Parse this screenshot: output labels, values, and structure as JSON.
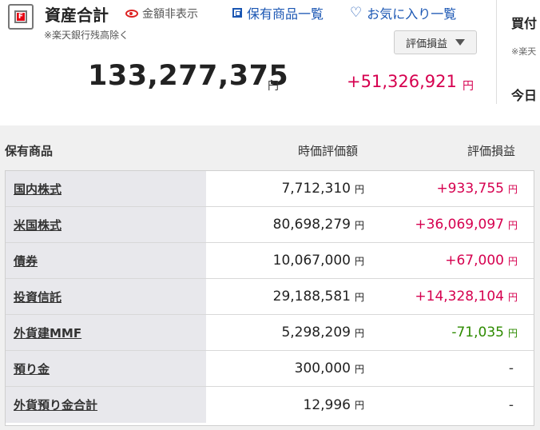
{
  "header": {
    "title": "資産合計",
    "hide_amount_label": "金額非表示",
    "note": "※楽天銀行残高除く",
    "link_holdings": "保有商品一覧",
    "link_favorites": "お気に入り一覧",
    "select_value": "評価損益"
  },
  "summary": {
    "total": "133,277,375",
    "total_unit": "円",
    "gain": "+51,326,921",
    "gain_unit": "円"
  },
  "right_column": {
    "line1": "買付",
    "line2": "※楽天",
    "line3": "今日"
  },
  "table": {
    "headers": {
      "name": "保有商品",
      "value": "時価評価額",
      "gain": "評価損益"
    },
    "rows": [
      {
        "name": "国内株式",
        "value": "7,712,310",
        "value_unit": "円",
        "gain": "+933,755",
        "gain_unit": "円",
        "sign": "pos"
      },
      {
        "name": "米国株式",
        "value": "80,698,279",
        "value_unit": "円",
        "gain": "+36,069,097",
        "gain_unit": "円",
        "sign": "pos"
      },
      {
        "name": "債券",
        "value": "10,067,000",
        "value_unit": "円",
        "gain": "+67,000",
        "gain_unit": "円",
        "sign": "pos"
      },
      {
        "name": "投資信託",
        "value": "29,188,581",
        "value_unit": "円",
        "gain": "+14,328,104",
        "gain_unit": "円",
        "sign": "pos"
      },
      {
        "name": "外貨建MMF",
        "value": "5,298,209",
        "value_unit": "円",
        "gain": "-71,035",
        "gain_unit": "円",
        "sign": "neg"
      },
      {
        "name": "預り金",
        "value": "300,000",
        "value_unit": "円",
        "gain": "-",
        "gain_unit": "",
        "sign": "none"
      },
      {
        "name": "外貨預り金合計",
        "value": "12,996",
        "value_unit": "円",
        "gain": "-",
        "gain_unit": "",
        "sign": "none"
      }
    ]
  },
  "colors": {
    "positive": "#d6004f",
    "negative": "#2e8b00",
    "link": "#1a56b3",
    "brand": "#e60012"
  },
  "icons": {
    "logo": "rakuten-safe-icon",
    "eye": "eye-icon",
    "holdings": "list-square-icon",
    "favorites": "heart-icon",
    "select": "triangle-down-icon"
  }
}
